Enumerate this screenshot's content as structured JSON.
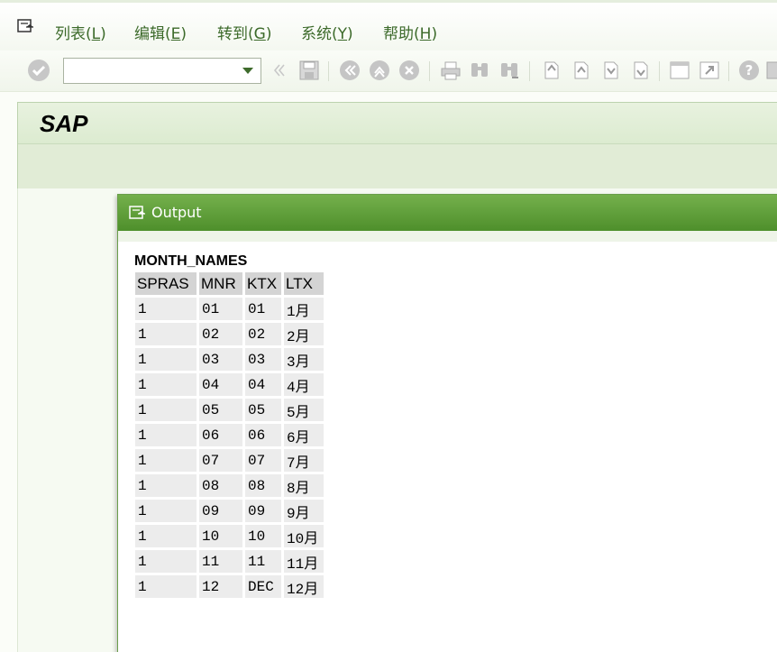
{
  "menu": {
    "items": [
      {
        "label": "列表(",
        "key": "L",
        "close": ")"
      },
      {
        "label": "编辑(",
        "key": "E",
        "close": ")"
      },
      {
        "label": "转到(",
        "key": "G",
        "close": ")"
      },
      {
        "label": "系统(",
        "key": "Y",
        "close": ")"
      },
      {
        "label": "帮助(",
        "key": "H",
        "close": ")"
      }
    ]
  },
  "toolbar": {
    "command_field_value": ""
  },
  "screen": {
    "title": "SAP"
  },
  "dialog": {
    "title": "Output",
    "list_title": "MONTH_NAMES",
    "columns": [
      "SPRAS",
      "MNR",
      "KTX",
      "LTX"
    ],
    "rows": [
      [
        "1",
        "01",
        "01",
        "1月"
      ],
      [
        "1",
        "02",
        "02",
        "2月"
      ],
      [
        "1",
        "03",
        "03",
        "3月"
      ],
      [
        "1",
        "04",
        "04",
        "4月"
      ],
      [
        "1",
        "05",
        "05",
        "5月"
      ],
      [
        "1",
        "06",
        "06",
        "6月"
      ],
      [
        "1",
        "07",
        "07",
        "7月"
      ],
      [
        "1",
        "08",
        "08",
        "8月"
      ],
      [
        "1",
        "09",
        "09",
        "9月"
      ],
      [
        "1",
        "10",
        "10",
        "10月"
      ],
      [
        "1",
        "11",
        "11",
        "11月"
      ],
      [
        "1",
        "12",
        "DEC",
        "12月"
      ]
    ]
  },
  "colors": {
    "header_green": "#5a9a35",
    "menu_text": "#3c6a2a",
    "title_bg": "#e3eed9"
  }
}
